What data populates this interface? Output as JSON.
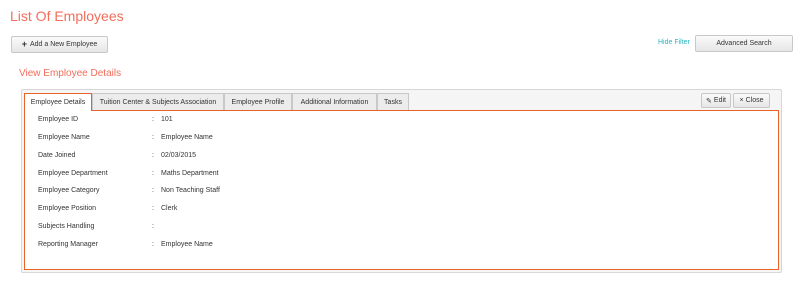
{
  "page": {
    "title": "List Of Employees"
  },
  "toolbar": {
    "add_label": "Add a New Employee",
    "hide_filter_label": "Hide Filter",
    "advanced_search_label": "Advanced Search"
  },
  "section": {
    "title": "View Employee Details"
  },
  "tabs": [
    {
      "label": "Employee Details",
      "active": true
    },
    {
      "label": "Tuition Center & Subjects Association",
      "active": false
    },
    {
      "label": "Employee Profile",
      "active": false
    },
    {
      "label": "Additional Information",
      "active": false
    },
    {
      "label": "Tasks",
      "active": false
    }
  ],
  "actions": {
    "edit_label": "Edit",
    "close_label": "Close"
  },
  "details": [
    {
      "label": "Employee ID",
      "value": "101"
    },
    {
      "label": "Employee Name",
      "value": "Employee Name"
    },
    {
      "label": "Date Joined",
      "value": "02/03/2015"
    },
    {
      "label": "Employee Department",
      "value": "Maths Department"
    },
    {
      "label": "Employee Category",
      "value": "Non Teaching Staff"
    },
    {
      "label": "Employee Position",
      "value": "Clerk"
    },
    {
      "label": "Subjects Handling",
      "value": ""
    },
    {
      "label": "Reporting Manager",
      "value": "Employee Name"
    }
  ],
  "separator": ":",
  "colors": {
    "accent": "#f26d5b",
    "tab_border": "#e8622a",
    "link": "#2bb3c0"
  }
}
